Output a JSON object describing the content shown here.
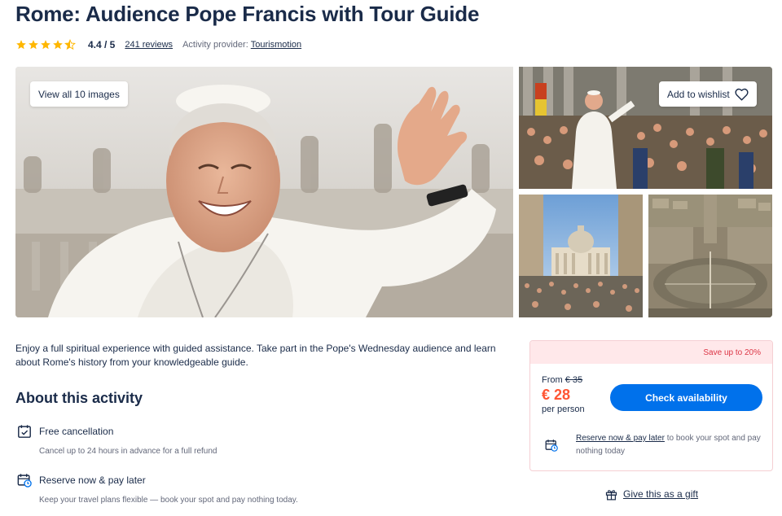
{
  "activity": {
    "title": "Rome: Audience Pope Francis with Tour Guide",
    "rating": {
      "stars": 4.4,
      "value_text": "4.4 / 5",
      "reviews_text": "241 reviews",
      "star_color": "#ffb700"
    },
    "provider": {
      "label": "Activity provider:",
      "name": "Tourismotion"
    }
  },
  "gallery": {
    "view_all_label": "View all 10 images",
    "wishlist_label": "Add to wishlist",
    "icons": {
      "wishlist": "heart-icon"
    }
  },
  "description": "Enjoy a full spiritual experience with guided assistance. Take part in the Pope's Wednesday audience and learn about Rome's history from your knowledgeable guide.",
  "about": {
    "title": "About this activity",
    "features": [
      {
        "icon": "calendar-check-icon",
        "title": "Free cancellation",
        "description": "Cancel up to 24 hours in advance for a full refund"
      },
      {
        "icon": "calendar-clock-icon",
        "title": "Reserve now & pay later",
        "description": "Keep your travel plans flexible — book your spot and pay nothing today."
      }
    ]
  },
  "booking": {
    "save_banner": "Save up to 20%",
    "from_label": "From",
    "old_price": "€ 35",
    "new_price": "€ 28",
    "per_person": "per person",
    "check_button": "Check availability",
    "reserve_link": "Reserve now & pay later",
    "reserve_text": " to book your spot and pay nothing today",
    "colors": {
      "accent": "#0071eb",
      "price": "#ff5533",
      "save": "#dc3545",
      "banner_bg": "#ffe8ea"
    }
  },
  "gift": {
    "label": "Give this as a gift",
    "icon": "gift-icon"
  }
}
